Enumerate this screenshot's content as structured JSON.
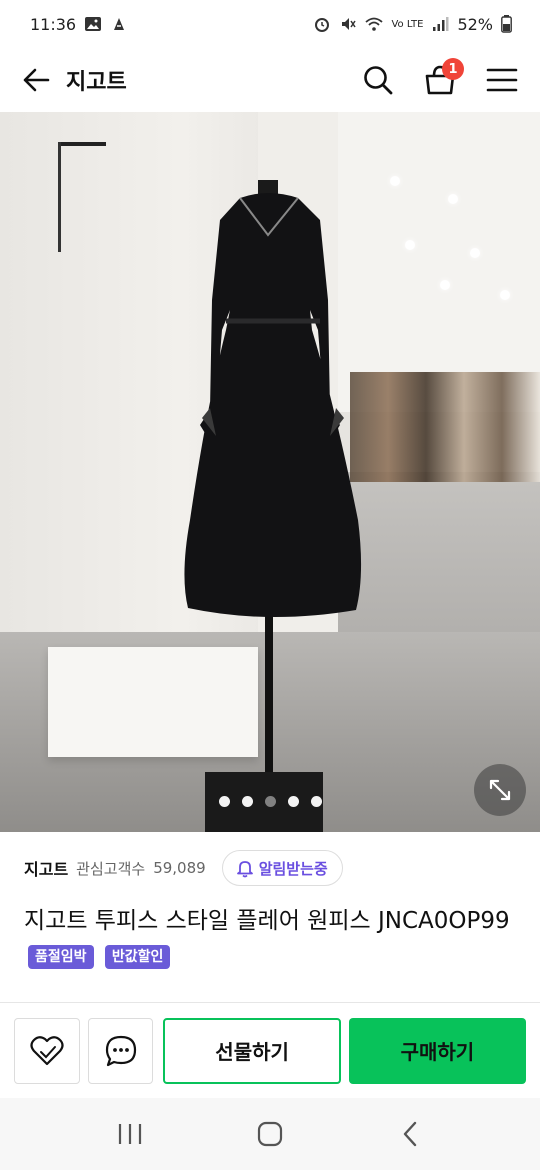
{
  "status_bar": {
    "time": "11:36",
    "battery": "52%",
    "network": "Vo LTE"
  },
  "header": {
    "title": "지고트",
    "cart_count": "1"
  },
  "gallery": {
    "slide_count": 5,
    "active_index": 2
  },
  "store": {
    "name": "지고트",
    "follower_label": "관심고객수",
    "follower_count": "59,089",
    "alarm_label": "알림받는중"
  },
  "product": {
    "title": "지고트 투피스 스타일 플레어 원피스 JNCA0OP99",
    "badges": [
      "품절임박",
      "반값할인"
    ]
  },
  "actions": {
    "gift_label": "선물하기",
    "buy_label": "구매하기"
  },
  "colors": {
    "primary_green": "#08c25a",
    "badge_purple": "#6a5bd8",
    "alarm_purple": "#6a4fe0",
    "cart_badge_red": "#f04438"
  }
}
